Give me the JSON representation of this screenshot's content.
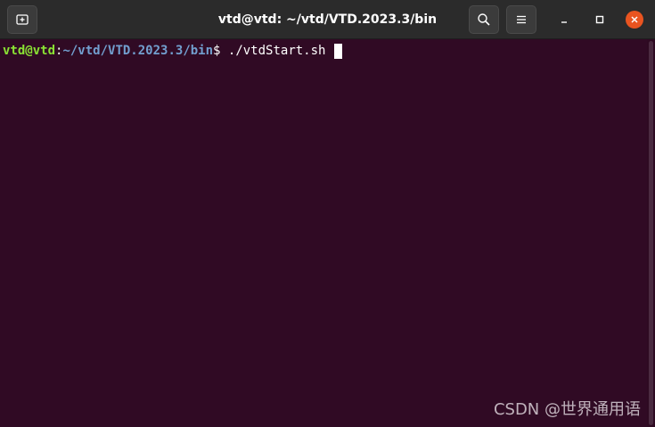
{
  "window": {
    "title": "vtd@vtd: ~/vtd/VTD.2023.3/bin",
    "close_color": "#e95420"
  },
  "icons": {
    "new_tab": "new-tab-icon",
    "search": "search-icon",
    "menu": "hamburger-menu-icon",
    "minimize": "minimize-icon",
    "maximize": "maximize-icon",
    "close": "close-icon"
  },
  "terminal": {
    "prompt_user": "vtd@vtd",
    "prompt_colon": ":",
    "prompt_path": "~/vtd/VTD.2023.3/bin",
    "prompt_symbol": "$ ",
    "command": "./vtdStart.sh ",
    "background": "#300a24"
  },
  "watermark": {
    "text": "CSDN @世界通用语"
  }
}
